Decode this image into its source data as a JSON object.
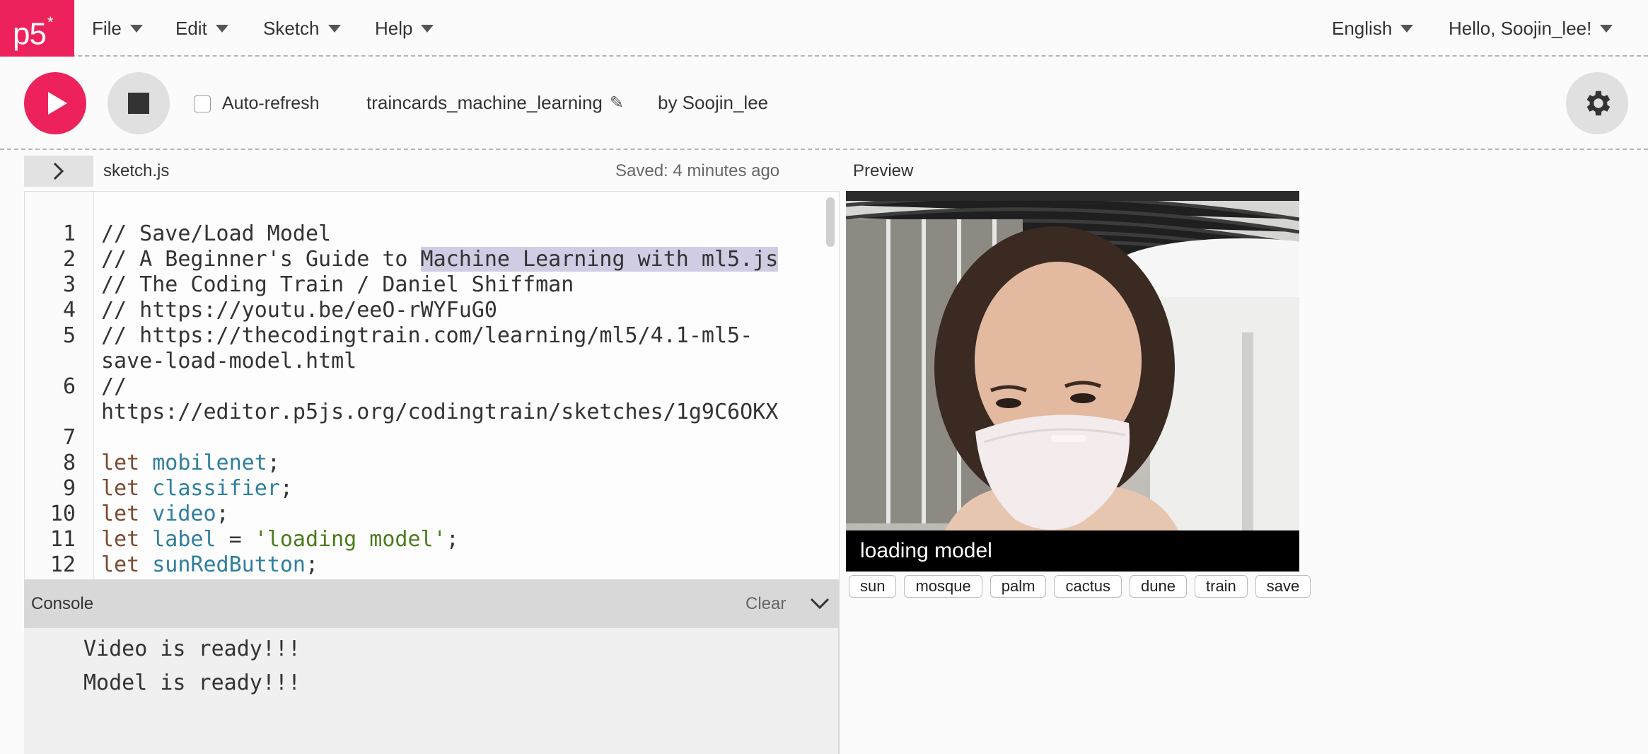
{
  "logo": {
    "text": "p5",
    "star": "*"
  },
  "menu": {
    "file": "File",
    "edit": "Edit",
    "sketch": "Sketch",
    "help": "Help",
    "language": "English",
    "user": "Hello, Soojin_lee!"
  },
  "toolbar": {
    "auto_refresh": "Auto-refresh",
    "auto_refresh_checked": false,
    "project_name": "traincards_machine_learning",
    "owner": "by Soojin_lee"
  },
  "editor": {
    "filename": "sketch.js",
    "saved_status": "Saved: 4 minutes ago",
    "lines": [
      {
        "n": "1",
        "text": "// Save/Load Model"
      },
      {
        "n": "2",
        "text_a": "// A Beginner's Guide to ",
        "text_b": "Machine Learning with ml5.js"
      },
      {
        "n": "3",
        "text": "// The Coding Train / Daniel Shiffman"
      },
      {
        "n": "4",
        "text": "// https://youtu.be/eeO-rWYFuG0"
      },
      {
        "n": "5",
        "text": "// https://thecodingtrain.com/learning/ml5/4.1-ml5-"
      },
      {
        "n": "",
        "text": "save-load-model.html"
      },
      {
        "n": "6",
        "text": "//"
      },
      {
        "n": "",
        "text": "https://editor.p5js.org/codingtrain/sketches/1g9C6OKX"
      },
      {
        "n": "7",
        "text": ""
      },
      {
        "n": "8",
        "kw": "let",
        "var": "mobilenet",
        "rest": ";"
      },
      {
        "n": "9",
        "kw": "let",
        "var": "classifier",
        "rest": ";"
      },
      {
        "n": "10",
        "kw": "let",
        "var": "video",
        "rest": ";"
      },
      {
        "n": "11",
        "kw": "let",
        "var": "label",
        "rest": " = ",
        "str": "'loading model'",
        "end": ";"
      },
      {
        "n": "12",
        "kw": "let",
        "var": "sunRedButton",
        "rest": ";"
      }
    ]
  },
  "console": {
    "title": "Console",
    "clear": "Clear",
    "messages": [
      "Video is ready!!!",
      "Model is ready!!!"
    ]
  },
  "preview": {
    "label": "Preview",
    "caption": "loading model",
    "buttons": [
      "sun",
      "mosque",
      "palm",
      "cactus",
      "dune",
      "train",
      "save"
    ]
  }
}
